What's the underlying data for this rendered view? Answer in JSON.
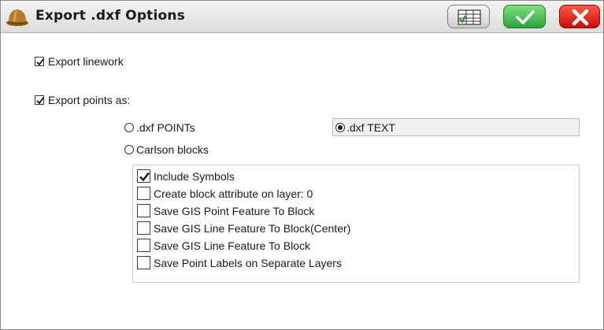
{
  "window": {
    "title": "Export .dxf Options"
  },
  "options": {
    "export_linework": {
      "label": "Export linework",
      "checked": true
    },
    "export_points": {
      "label": "Export points as:",
      "checked": true
    }
  },
  "radios": {
    "dxf_points": {
      "label": ".dxf POINTs",
      "selected": false
    },
    "dxf_text": {
      "label": ".dxf TEXT",
      "selected": true
    },
    "carlson_blocks": {
      "label": "Carlson blocks",
      "selected": false
    }
  },
  "block_options": [
    {
      "label": "Include Symbols",
      "checked": true
    },
    {
      "label": "Create block attribute on layer: 0",
      "checked": false
    },
    {
      "label": "Save GIS Point Feature To Block",
      "checked": false
    },
    {
      "label": "Save GIS Line Feature To Block(Center)",
      "checked": false
    },
    {
      "label": "Save GIS Line Feature To Block",
      "checked": false
    },
    {
      "label": "Save Point Labels on Separate Layers",
      "checked": false
    }
  ],
  "icons": {
    "app": "hard-hat-icon",
    "view": "table-view-icon",
    "ok": "checkmark-icon",
    "cancel": "close-x-icon"
  },
  "colors": {
    "ok_green": "#2ca33a",
    "cancel_red": "#c80d0d"
  }
}
